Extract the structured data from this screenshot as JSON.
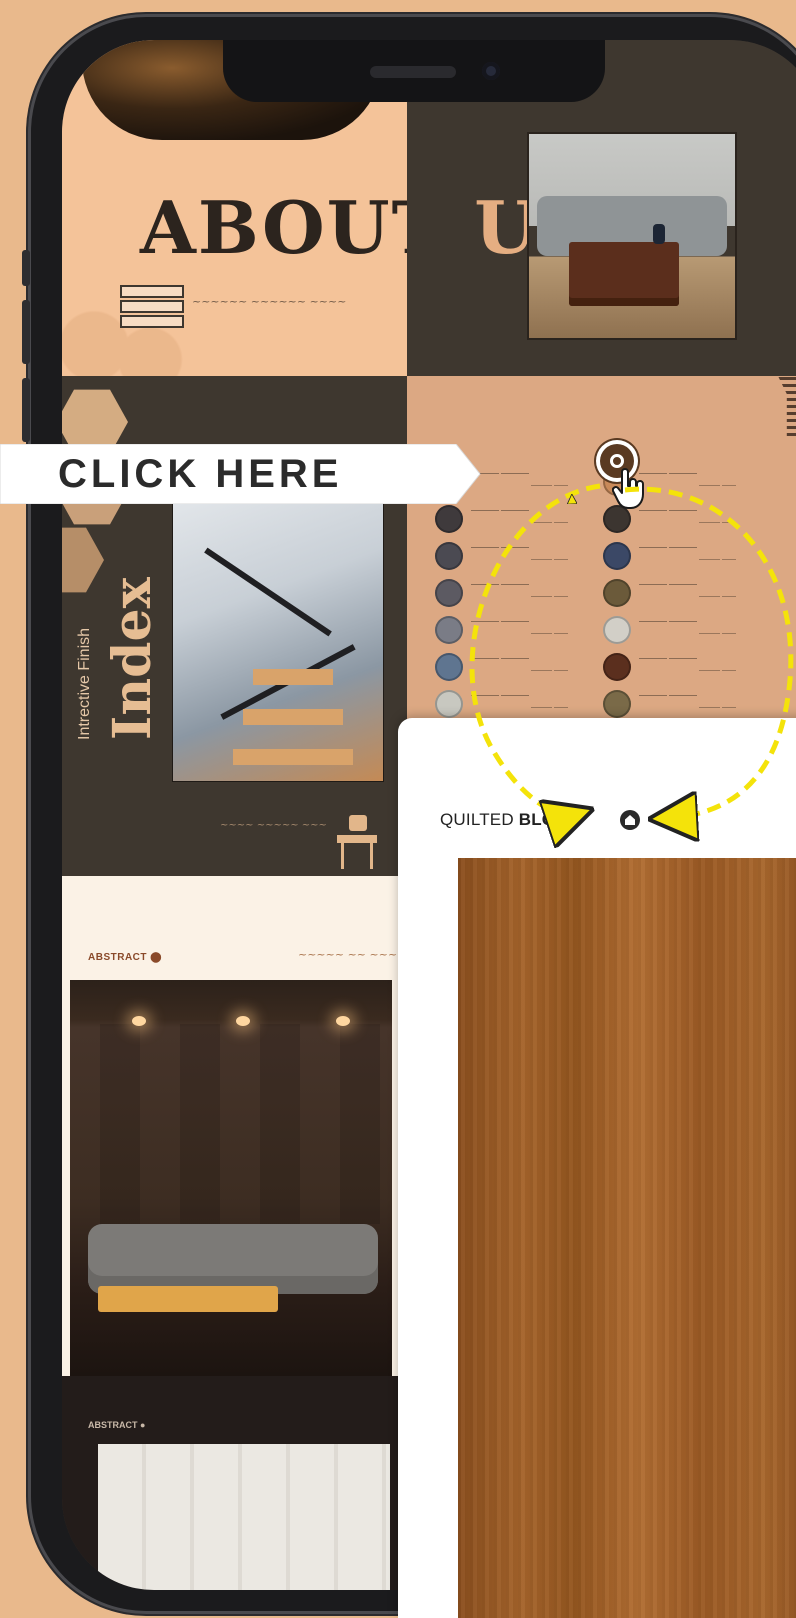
{
  "banner": {
    "cta_label": "CLICK HERE"
  },
  "pages": {
    "about": {
      "title_part1": "ABOUT",
      "title_part2": "US"
    },
    "index": {
      "subtitle": "Intrective Finish",
      "title": "Index"
    },
    "abstract1": {
      "label": "ABSTRACT"
    },
    "abstract2": {
      "label": "ABSTRACT"
    }
  },
  "swatch_popup": {
    "title_regular": "QUILTED ",
    "title_bold": "BLOCK"
  },
  "swatch_colors": {
    "left": [
      "#3a2a22",
      "#3f3a3c",
      "#4b4a52",
      "#5c5a62",
      "#7a7c86",
      "#5f7590",
      "#c8c8c0",
      "#3a2517"
    ],
    "right": [
      "#c98a5a",
      "#3c3530",
      "#3b4866",
      "#6b5a3a",
      "#d2cfc7",
      "#5b2f1e",
      "#7a6a48",
      "#3a2a20"
    ]
  },
  "colors": {
    "background": "#e9b98c",
    "accent_arrow": "#f4e30a",
    "dark_panel": "#3e372f",
    "peach_panel": "#f4c399"
  },
  "icons": {
    "hotspot": "target-icon",
    "cursor": "hand-pointer-icon",
    "popup": "home-icon"
  }
}
